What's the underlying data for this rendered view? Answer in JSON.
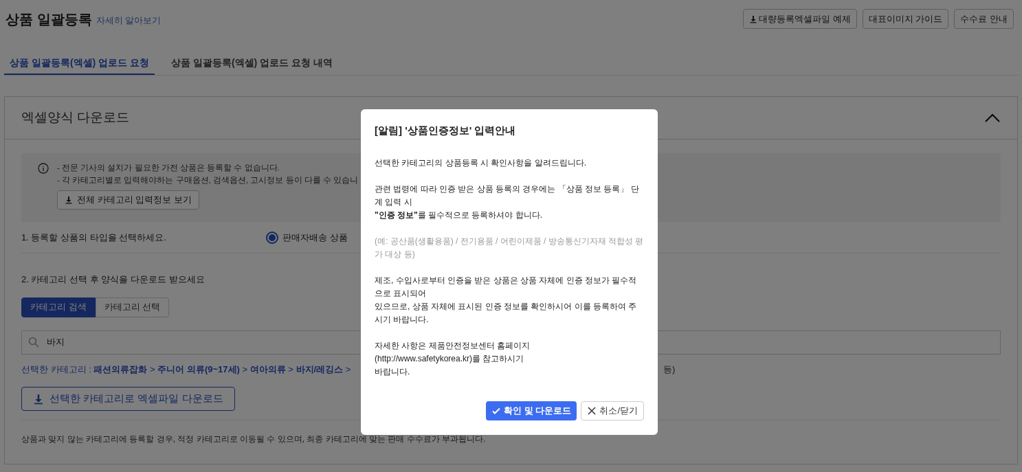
{
  "header": {
    "title": "상품 일괄등록",
    "help_link": "자세히 알아보기",
    "buttons": [
      {
        "label": "대량등록엑셀파일 예제",
        "kind": "download"
      },
      {
        "label": "대표이미지 가이드",
        "kind": "plain"
      },
      {
        "label": "수수료 안내",
        "kind": "plain"
      }
    ]
  },
  "tabs": [
    {
      "label": "상품 일괄등록(엑셀) 업로드 요청",
      "selected": true
    },
    {
      "label": "상품 일괄등록(엑셀) 업로드 요청 내역",
      "selected": false
    }
  ],
  "section": {
    "title": "엑셀양식 다운로드",
    "expanded": true,
    "notice": {
      "lines": [
        "- 전문 기사의 설치가 필요한 가전 상품은 등록할 수 없습니다.",
        "- 각 카테고리별로 입력해야하는 구매옵션, 검색옵션, 고시정보 등이 다를 수 있습니"
      ],
      "button": "전체 카테고리 입력정보 보기"
    },
    "step1": {
      "label": "1. 등록할 상품의 타입을 선택하세요.",
      "options": [
        {
          "label": "판매자배송 상품",
          "selected": true
        }
      ]
    },
    "step2": {
      "label": "2. 카테고리 선택 후 양식을 다운로드 받으세요",
      "modes": [
        {
          "label": "카테고리 검색",
          "selected": true
        },
        {
          "label": "카테고리 선택",
          "selected": false
        }
      ],
      "search": {
        "value": "바지"
      },
      "breadcrumb": {
        "label": "선택한 카테고리 :",
        "separator": ">",
        "path": [
          "패션의류잡화",
          "주니어 의류(9~17세)",
          "여아의류",
          "바지/레깅스"
        ],
        "trailing": "등)"
      },
      "download_button": "선택한 카테고리로 엑셀파일 다운로드"
    },
    "footnote": "상품과 맞지 않는 카테고리에 등록할 경우, 적정 카테고리로 이동될 수 있으며, 최종 카테고리에 맞는 판매 수수료가 부과됩니다."
  },
  "modal": {
    "title": "[알림] '상품인증정보' 입력안내",
    "paragraphs": [
      {
        "kind": "normal",
        "lines": [
          "선택한 카테고리의 상품등록 시 확인사항을 알려드립니다."
        ]
      },
      {
        "kind": "normal",
        "lines": [
          "관련 법령에 따라 인증 받은 상품 등록의 경우에는 「상품 정보 등록」 단계 입력 시",
          "**\"인증 정보\"**를 필수적으로 등록하셔야 합니다."
        ]
      },
      {
        "kind": "muted",
        "lines": [
          "(예: 공산품(생활용품) / 전기용품 / 어린이제품 / 방송통신기자재 적합성 평가 대상 등)"
        ]
      },
      {
        "kind": "normal",
        "lines": [
          "제조, 수입사로부터 인증을 받은 상품은 상품 자체에 인증 정보가 필수적으로 표시되어",
          "있으므로, 상품 자체에 표시된 인증 정보를 확인하시어 이를 등록하여 주시기 바랍니다."
        ]
      },
      {
        "kind": "normal",
        "lines": [
          "자세한 사항은 제품안전정보센터 홈페이지",
          "(http://www.safetykorea.kr)를 참고하시기",
          "바랍니다."
        ]
      }
    ],
    "buttons": [
      {
        "label": "확인 및 다운로드",
        "kind": "primary"
      },
      {
        "label": "취소/닫기",
        "kind": "secondary"
      }
    ]
  }
}
